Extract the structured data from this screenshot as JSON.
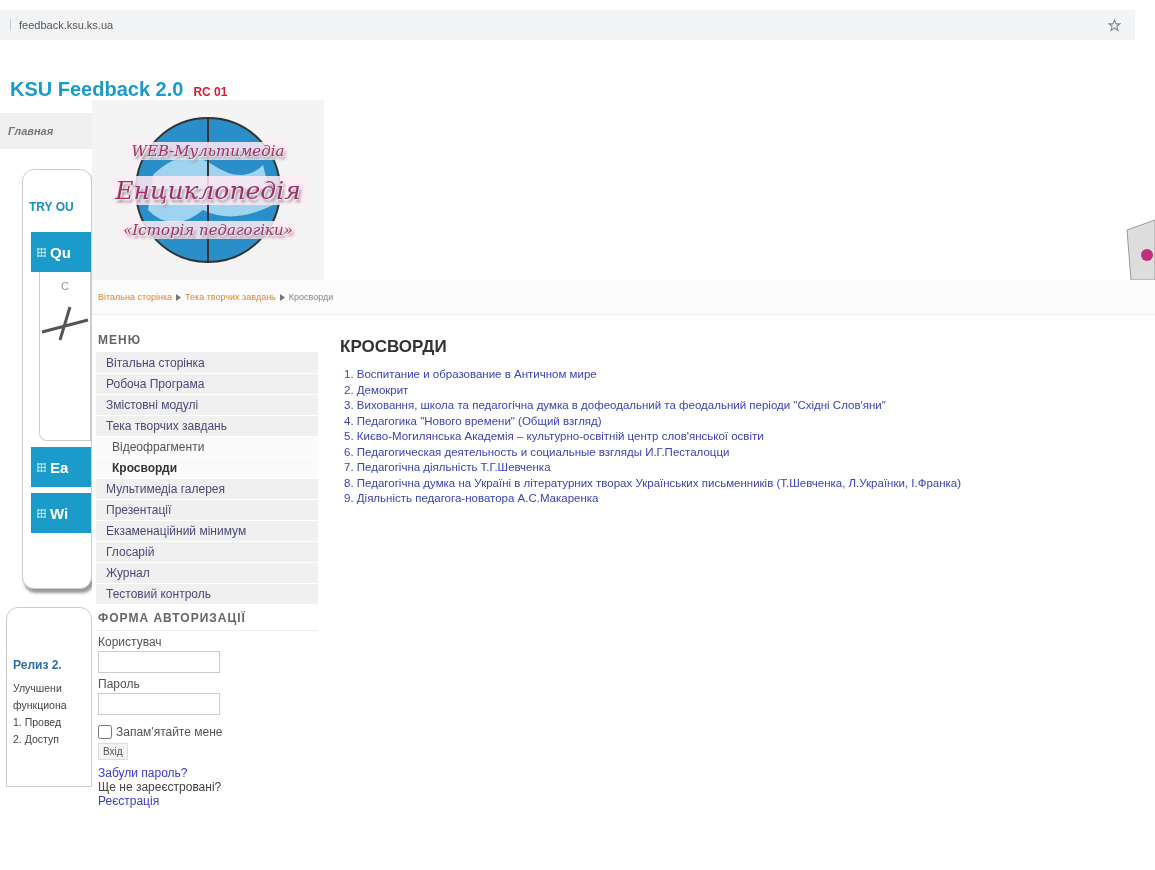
{
  "address_bar": {
    "url": "feedback.ksu.ks.ua"
  },
  "background_page": {
    "title": "KSU Feedback 2.0",
    "badge": "RC 01",
    "nav": [
      "Главная"
    ],
    "card": {
      "heading": "TRY OU",
      "buttons": [
        {
          "label": "Qu",
          "content": "C"
        },
        {
          "label": "Ea"
        },
        {
          "label": "Wi"
        }
      ]
    },
    "release": {
      "title": "Релиз 2.",
      "lines": [
        "Улучшени",
        "функциона",
        "1. Провед",
        "2. Доступ"
      ]
    }
  },
  "overlay": {
    "logo": [
      "WEB-Мультимедіа",
      "Енциклопедія",
      "«Історія педагогіки»"
    ],
    "breadcrumb": [
      {
        "label": "Вітальна сторінка",
        "current": false
      },
      {
        "label": "Тека творчих завдань",
        "current": false
      },
      {
        "label": "Кросворди",
        "current": true
      }
    ],
    "menu": {
      "heading": "МЕНЮ",
      "items": [
        {
          "label": "Вітальна сторінка",
          "selected": false
        },
        {
          "label": "Робоча Програма",
          "selected": false
        },
        {
          "label": "Змістовні модулі",
          "selected": false
        },
        {
          "label": "Тека творчих завдань",
          "selected": false,
          "children": [
            {
              "label": "Відеофрагменти",
              "selected": false
            },
            {
              "label": "Кросворди",
              "selected": true
            }
          ]
        },
        {
          "label": "Мультимедіа галерея",
          "selected": false
        },
        {
          "label": "Презентації",
          "selected": false
        },
        {
          "label": "Екзаменаційний мінимум",
          "selected": false
        },
        {
          "label": "Глосарій",
          "selected": false
        },
        {
          "label": "Журнал",
          "selected": false
        },
        {
          "label": "Тестовий контроль",
          "selected": false
        }
      ]
    },
    "login": {
      "heading": "ФОРМА АВТОРИЗАЦІЇ",
      "user_label": "Користувач",
      "password_label": "Пароль",
      "remember": {
        "label": "Запам'ятайте мене",
        "checked": false
      },
      "submit": "Вхід",
      "forgot": "Забули пароль?",
      "not_registered": "Ще не зареєстровані?",
      "register": "Реєстрація"
    },
    "content": {
      "title": "КРОСВОРДИ",
      "links": [
        "1. Воспитание и образование в Античном мире",
        "2. Демокрит",
        "3. Виховання, школа та педагогічна думка в дофеодальний та феодальний періоди \"Східні Слов'яни\"",
        "4. Педагогика \"Нового времени\" (Общий взгляд)",
        "5. Києво-Могилянська Академія – культурно-освітній центр слов'янської освіти",
        "6. Педагогическая деятельность и социальные взгляды И.Г.Песталоцци",
        "7. Педагогічна діяльність Т.Г.Шевченка",
        "8. Педагогічна думка на Україні в літературних творах Українських письменників (Т.Шевченка, Л.Українки, І.Франка)",
        "9. Діяльність педагога-новатора А.С.Макаренка"
      ]
    }
  }
}
